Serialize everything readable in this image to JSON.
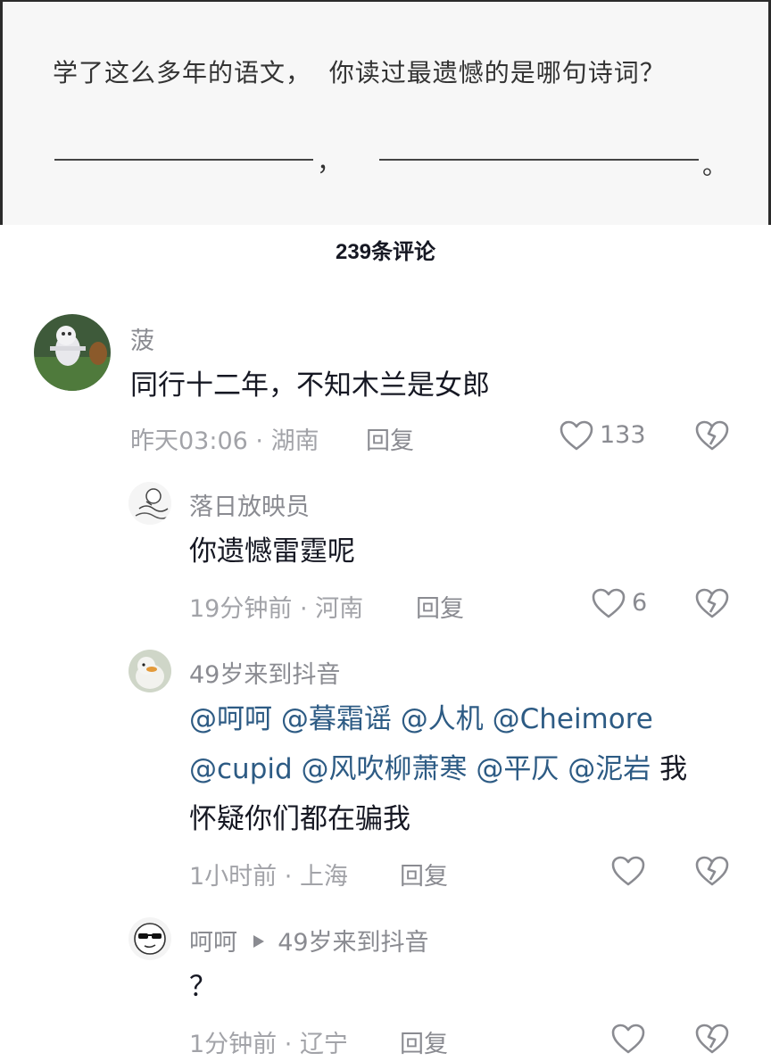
{
  "post": {
    "question": "学了这么多年的语文，  你读过最遗憾的是哪句诗词？",
    "comma": "，",
    "period": "。"
  },
  "comments_header": {
    "count_label": "239条评论"
  },
  "comments": [
    {
      "name": "菠",
      "text": "同行十二年，不知木兰是女郎",
      "time": "昨天03:06",
      "location": "湖南",
      "reply": "回复",
      "likes": "133"
    },
    {
      "name": "落日放映员",
      "text": "你遗憾雷霆呢",
      "time": "19分钟前",
      "location": "河南",
      "reply": "回复",
      "likes": "6"
    },
    {
      "name": "49岁来到抖音",
      "mentions": [
        "@呵呵",
        "@暮霜谣",
        "@人机",
        "@Cheimore",
        "@cupid",
        "@风吹柳萧寒",
        "@平仄",
        "@泥岩"
      ],
      "text_tail_1": "我",
      "text_tail_2": "怀疑你们都在骗我",
      "time": "1小时前",
      "location": "上海",
      "reply": "回复"
    },
    {
      "name": "呵呵",
      "reply_to": "49岁来到抖音",
      "text": "？",
      "time": "1分钟前",
      "location": "辽宁",
      "reply": "回复"
    }
  ],
  "meta_separator": " · ",
  "colors": {
    "mention": "#2d5b84",
    "meta": "#a2a3a8",
    "name": "#8a8b91"
  },
  "icons": [
    "heart-icon",
    "broken-heart-icon",
    "play-triangle-icon"
  ]
}
